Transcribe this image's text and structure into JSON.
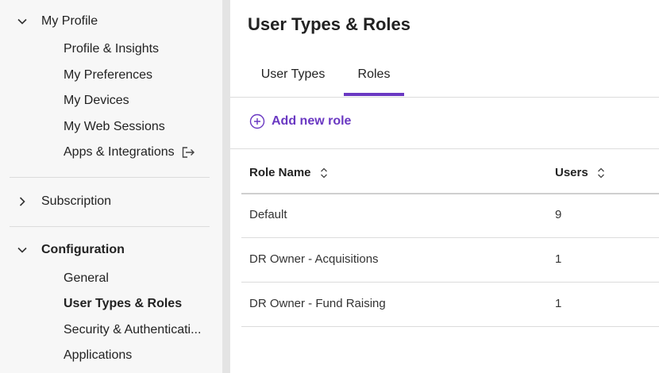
{
  "sidebar": {
    "my_profile": {
      "label": "My Profile",
      "items": [
        {
          "label": "Profile & Insights"
        },
        {
          "label": "My Preferences"
        },
        {
          "label": "My Devices"
        },
        {
          "label": "My Web Sessions"
        },
        {
          "label": "Apps & Integrations"
        }
      ]
    },
    "subscription": {
      "label": "Subscription"
    },
    "configuration": {
      "label": "Configuration",
      "items": [
        {
          "label": "General"
        },
        {
          "label": "User Types & Roles"
        },
        {
          "label": "Security & Authenticati..."
        },
        {
          "label": "Applications"
        }
      ]
    }
  },
  "main": {
    "title": "User Types & Roles",
    "tabs": [
      {
        "label": "User Types"
      },
      {
        "label": "Roles"
      }
    ],
    "add_role_label": "Add new role",
    "table": {
      "columns": [
        "Role Name",
        "Users"
      ],
      "rows": [
        {
          "name": "Default",
          "users": "9"
        },
        {
          "name": "DR Owner - Acquisitions",
          "users": "1"
        },
        {
          "name": "DR Owner - Fund Raising",
          "users": "1"
        }
      ]
    }
  },
  "colors": {
    "accent": "#6a38c2"
  },
  "icons": [
    "chevron-down-icon",
    "chevron-right-icon",
    "external-link-icon",
    "plus-circle-icon",
    "sort-icon"
  ]
}
